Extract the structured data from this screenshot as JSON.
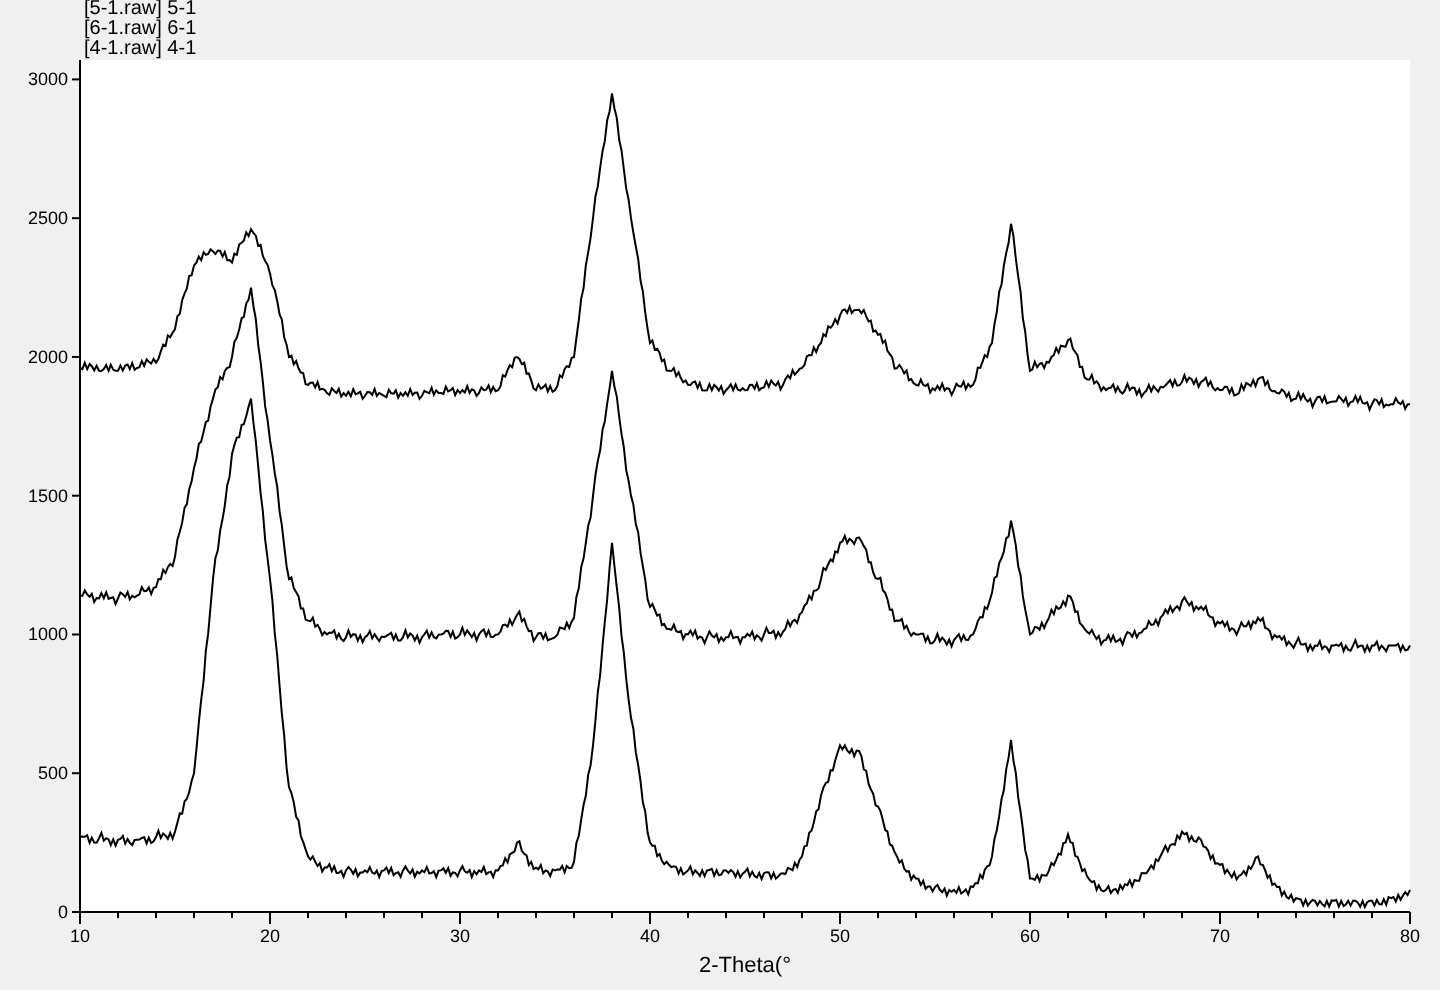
{
  "legend": [
    "[5-1.raw]",
    "[6-1.raw]",
    "[4-1.raw]"
  ],
  "chart_data": {
    "type": "line",
    "xlabel": "2-Theta(°",
    "xlim": [
      10,
      80
    ],
    "ylim": [
      0,
      3070
    ],
    "xticks": [
      10,
      20,
      30,
      40,
      50,
      60,
      70,
      80
    ],
    "yticks": [
      0,
      500,
      1000,
      1500,
      2000,
      2500,
      3000
    ],
    "x": [
      10,
      11,
      12,
      13,
      14,
      15,
      16,
      17,
      18,
      19,
      20,
      21,
      22,
      23,
      24,
      25,
      26,
      27,
      28,
      29,
      30,
      31,
      32,
      33,
      34,
      35,
      36,
      37,
      38,
      39,
      40,
      41,
      42,
      43,
      44,
      45,
      46,
      47,
      48,
      49,
      50,
      51,
      52,
      53,
      54,
      55,
      56,
      57,
      58,
      59,
      60,
      61,
      62,
      63,
      64,
      65,
      66,
      67,
      68,
      69,
      70,
      71,
      72,
      73,
      74,
      75,
      76,
      77,
      78,
      79,
      80
    ],
    "series": [
      {
        "name": "5-1",
        "color": "#000000",
        "values": [
          1960,
          1950,
          1950,
          1960,
          1980,
          2100,
          2330,
          2380,
          2340,
          2460,
          2300,
          2000,
          1900,
          1870,
          1860,
          1860,
          1860,
          1860,
          1860,
          1870,
          1870,
          1870,
          1880,
          2000,
          1880,
          1880,
          2000,
          2500,
          2950,
          2500,
          2050,
          1950,
          1900,
          1880,
          1880,
          1880,
          1890,
          1900,
          1960,
          2050,
          2150,
          2170,
          2080,
          1960,
          1900,
          1880,
          1880,
          1900,
          2050,
          2480,
          1950,
          1980,
          2060,
          1920,
          1880,
          1880,
          1870,
          1890,
          1910,
          1910,
          1880,
          1870,
          1920,
          1870,
          1850,
          1840,
          1840,
          1840,
          1830,
          1830,
          1830
        ]
      },
      {
        "name": "6-1",
        "color": "#000000",
        "values": [
          1140,
          1130,
          1130,
          1140,
          1170,
          1280,
          1600,
          1850,
          2000,
          2250,
          1700,
          1200,
          1050,
          1000,
          990,
          990,
          990,
          990,
          990,
          1000,
          1000,
          1000,
          1000,
          1070,
          990,
          990,
          1060,
          1500,
          1950,
          1500,
          1100,
          1020,
          1000,
          990,
          990,
          990,
          1000,
          1010,
          1080,
          1200,
          1330,
          1350,
          1200,
          1050,
          1000,
          980,
          980,
          1000,
          1150,
          1410,
          1000,
          1060,
          1140,
          1010,
          980,
          990,
          1020,
          1070,
          1120,
          1100,
          1040,
          1020,
          1060,
          990,
          970,
          960,
          960,
          960,
          960,
          960,
          960
        ]
      },
      {
        "name": "4-1",
        "color": "#000000",
        "values": [
          270,
          265,
          260,
          260,
          270,
          290,
          500,
          1200,
          1650,
          1850,
          1200,
          450,
          200,
          160,
          150,
          150,
          150,
          150,
          150,
          150,
          150,
          150,
          150,
          250,
          160,
          150,
          180,
          600,
          1330,
          700,
          250,
          170,
          150,
          150,
          150,
          145,
          140,
          140,
          200,
          420,
          600,
          580,
          380,
          200,
          120,
          90,
          80,
          90,
          200,
          620,
          120,
          150,
          280,
          130,
          80,
          100,
          140,
          220,
          290,
          260,
          170,
          130,
          200,
          90,
          50,
          40,
          40,
          40,
          40,
          50,
          80
        ]
      }
    ]
  }
}
